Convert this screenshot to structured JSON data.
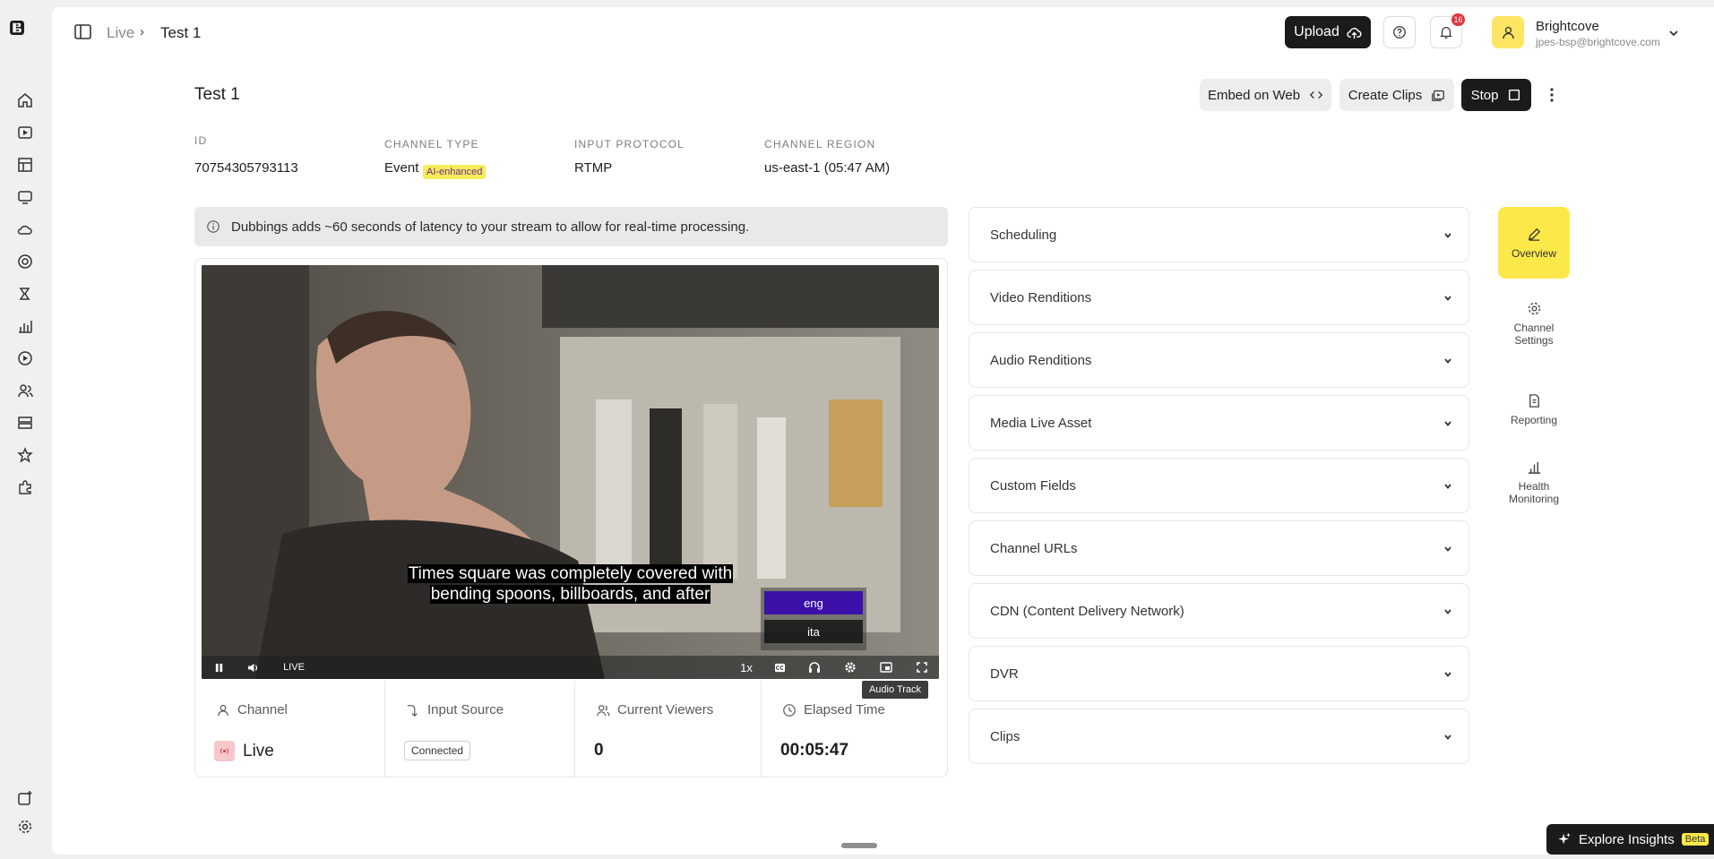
{
  "breadcrumb": {
    "root": "Live",
    "separator": "›",
    "current": "Test 1"
  },
  "header": {
    "upload_label": "Upload",
    "notification_count": "16",
    "account_name": "Brightcove",
    "account_email": "jpes-bsp@brightcove.com"
  },
  "page": {
    "title": "Test 1",
    "embed_label": "Embed on Web",
    "create_clips_label": "Create Clips",
    "stop_label": "Stop"
  },
  "meta": {
    "id_label": "ID",
    "id_value": "70754305793113",
    "channel_type_label": "CHANNEL TYPE",
    "channel_type_value": "Event",
    "ai_badge": "AI-enhanced",
    "input_protocol_label": "INPUT PROTOCOL",
    "input_protocol_value": "RTMP",
    "channel_region_label": "CHANNEL REGION",
    "channel_region_value": "us-east-1 (05:47 AM)"
  },
  "notice": "Dubbings adds ~60 seconds of latency to your stream to allow for real-time processing.",
  "player": {
    "caption_line1": "Times square was completely covered with",
    "caption_line2": "bending spoons, billboards, and after",
    "live_label": "LIVE",
    "rate_label": "1x",
    "audio_tracks": [
      "eng",
      "ita"
    ],
    "tooltip": "Audio Track"
  },
  "stats": {
    "channel_label": "Channel",
    "channel_value": "Live",
    "input_label": "Input Source",
    "input_value": "Connected",
    "viewers_label": "Current Viewers",
    "viewers_value": "0",
    "elapsed_label": "Elapsed Time",
    "elapsed_value": "00:05:47"
  },
  "accordion": [
    "Scheduling",
    "Video Renditions",
    "Audio Renditions",
    "Media Live Asset",
    "Custom Fields",
    "Channel URLs",
    "CDN (Content Delivery Network)",
    "DVR",
    "Clips"
  ],
  "tabs": {
    "overview": "Overview",
    "settings_line1": "Channel",
    "settings_line2": "Settings",
    "reporting": "Reporting",
    "health_line1": "Health",
    "health_line2": "Monitoring"
  },
  "explore": {
    "label": "Explore Insights",
    "badge": "Beta"
  },
  "colors": {
    "accent": "#fde84a",
    "dark": "#1b1b1b",
    "selected_track": "#3a10a8",
    "badge_red": "#e0343b"
  }
}
